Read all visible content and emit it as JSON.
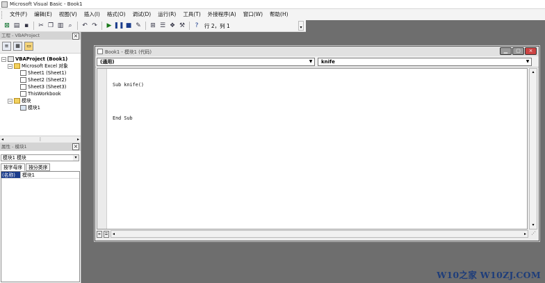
{
  "app": {
    "title": "Microsoft Visual Basic - Book1"
  },
  "menu": {
    "items": [
      "文件(F)",
      "编辑(E)",
      "视图(V)",
      "插入(I)",
      "格式(O)",
      "调试(D)",
      "运行(R)",
      "工具(T)",
      "外接程序(A)",
      "窗口(W)",
      "帮助(H)"
    ]
  },
  "toolbar": {
    "position_label": "行 2，列 1",
    "icons": [
      "excel-icon",
      "insert-userform-icon",
      "save-icon",
      "cut-icon",
      "copy-icon",
      "paste-icon",
      "find-icon",
      "undo-icon",
      "redo-icon",
      "run-icon",
      "break-icon",
      "reset-icon",
      "design-mode-icon",
      "project-explorer-icon",
      "properties-icon",
      "object-browser-icon",
      "toolbox-icon",
      "help-icon"
    ]
  },
  "project_explorer": {
    "title": "工程 - VBAProject",
    "tree": {
      "project": "VBAProject (Book1)",
      "excel_objects": "Microsoft Excel 对象",
      "sheet1": "Sheet1 (Sheet1)",
      "sheet2": "Sheet2 (Sheet2)",
      "sheet3": "Sheet3 (Sheet3)",
      "workbook": "ThisWorkbook",
      "modules": "模块",
      "module1": "模块1"
    }
  },
  "properties": {
    "title": "属性 - 模块1",
    "object_selector": "模块1 模块",
    "tabs": [
      "按字母序",
      "按分类序"
    ],
    "rows": [
      {
        "name": "(名称)",
        "value": "模块1"
      }
    ]
  },
  "code_window": {
    "title": "Book1 - 模块1 (代码)",
    "object_combo": "(通用)",
    "procedure_combo": "knife",
    "code_lines": [
      "Sub knife()",
      "",
      "End Sub"
    ]
  },
  "watermark": "W10之家 W10ZJ.COM",
  "colors": {
    "desktop": "#6e6e6e",
    "selection": "#1a3c8c",
    "watermark": "#1e3d7a"
  }
}
